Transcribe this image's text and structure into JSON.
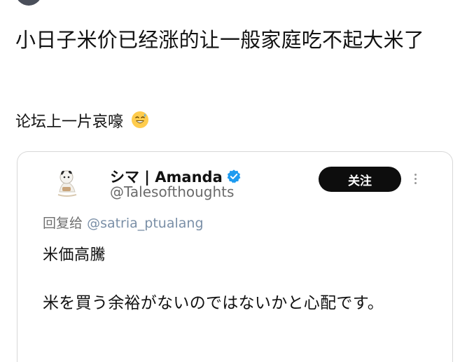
{
  "post": {
    "title": "小日子米价已经涨的让一般家庭吃不起大米了",
    "subtitle": "论坛上一片哀嚎"
  },
  "tweet": {
    "display_name": "シマ | Amanda",
    "handle": "@Talesofthoughts",
    "follow_label": "关注",
    "reply_prefix": "回复给",
    "reply_to": "@satria_ptualang",
    "text_line_1": "米価高騰",
    "text_line_2": "米を買う余裕がないのではないかと心配です。"
  },
  "icons": {
    "verified": "verified-badge-icon",
    "more": "more-options-icon",
    "emoji": "grinning-face-sweat-emoji"
  },
  "colors": {
    "verified_blue": "#1d9bf0",
    "follow_button_bg": "#0d0d0d",
    "mention_blue": "#7a8fa7"
  }
}
